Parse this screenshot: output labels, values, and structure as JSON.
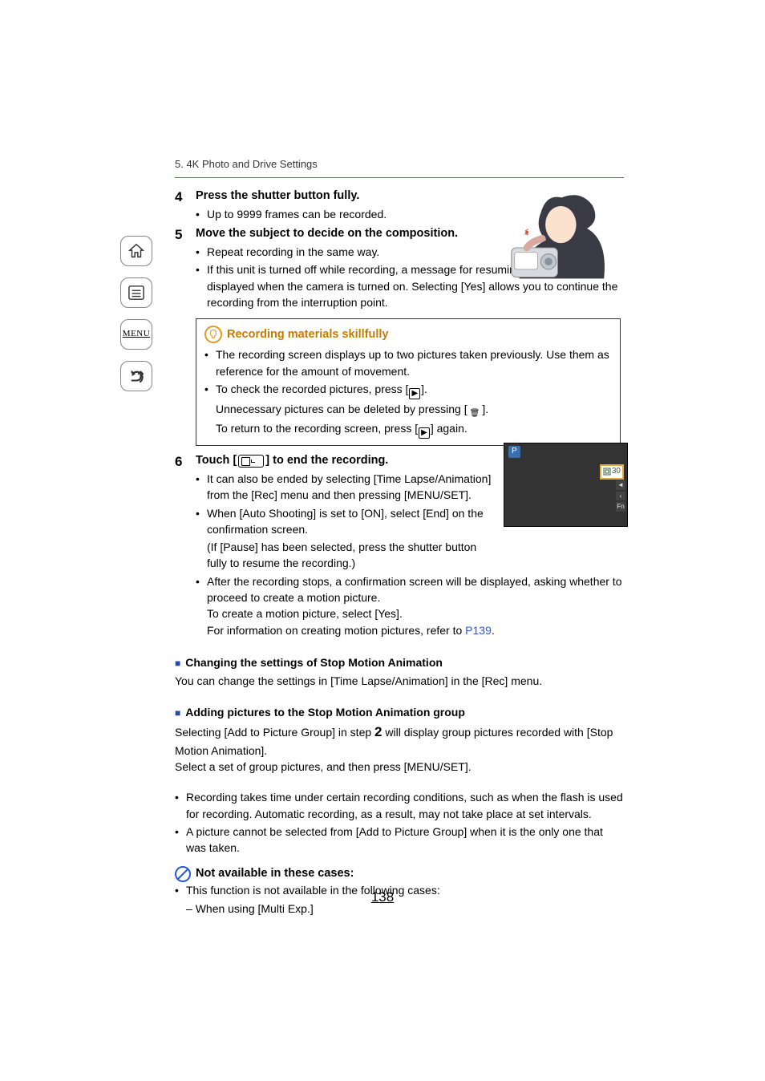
{
  "breadcrumb": "5. 4K Photo and Drive Settings",
  "sidebar": {
    "home": "home-icon",
    "toc": "toc-icon",
    "menu": "MENU",
    "back": "back-icon"
  },
  "steps": {
    "s4": {
      "num": "4",
      "title": "Press the shutter button fully.",
      "b1": "Up to 9999 frames can be recorded."
    },
    "s5": {
      "num": "5",
      "title": "Move the subject to decide on the composition.",
      "b1": "Repeat recording in the same way.",
      "b2": "If this unit is turned off while recording, a message for resuming the recording is displayed when the camera is turned on. Selecting [Yes] allows you to continue the recording from the interruption point."
    },
    "s6": {
      "num": "6",
      "title_pre": "Touch [",
      "title_post": "] to end the recording.",
      "b1": "It can also be ended by selecting [Time Lapse/Animation] from the [Rec] menu and then pressing [MENU/SET].",
      "b2_pre": "When [Auto Shooting] is set to ",
      "b2_on": "[ON]",
      "b2_post": ", select [End] on the confirmation screen.",
      "b2_paren": "(If [Pause] has been selected, press the shutter button fully to resume the recording.)",
      "b3a": "After the recording stops, a confirmation screen will be displayed, asking whether to proceed to create a motion picture.",
      "b3b": "To create a motion picture, select [Yes].",
      "b3c_pre": "For information on creating motion pictures, refer to ",
      "b3c_link": "P139",
      "b3c_post": "."
    }
  },
  "hint": {
    "title": "Recording materials skillfully",
    "l1": "The recording screen displays up to two pictures taken previously. Use them as reference for the amount of movement.",
    "l2_pre": "To check the recorded pictures, press [",
    "l2_post": "].",
    "l3_pre": "Unnecessary pictures can be deleted by pressing [",
    "l3_post": "].",
    "l4_pre": "To return to the recording screen, press [",
    "l4_post": "] again."
  },
  "sec1": {
    "h": "Changing the settings of Stop Motion Animation",
    "p": "You can change the settings in [Time Lapse/Animation] in the [Rec] menu."
  },
  "sec2": {
    "h": "Adding pictures to the Stop Motion Animation group",
    "p1_pre": "Selecting [Add to Picture Group] in step ",
    "p1_num": "2",
    "p1_post": " will display group pictures recorded with [Stop Motion Animation].",
    "p2": "Select a set of group pictures, and then press [MENU/SET]."
  },
  "notes": {
    "n1": "Recording takes time under certain recording conditions, such as when the flash is used for recording. Automatic recording, as a result, may not take place at set intervals.",
    "n2_pre": "A picture cannot be selected from ",
    "n2_mid": "[Add to Picture Group]",
    "n2_post": " when it is the only one that was taken."
  },
  "not_avail": {
    "h": "Not available in these cases:",
    "l1": "This function is not available in the following cases:",
    "l2": "When using [Multi Exp.]"
  },
  "screen": {
    "mode": "P",
    "count": "30"
  },
  "page_number": "138",
  "icons": {
    "play": "▶",
    "trash": "🗑",
    "bulb": "💡"
  }
}
